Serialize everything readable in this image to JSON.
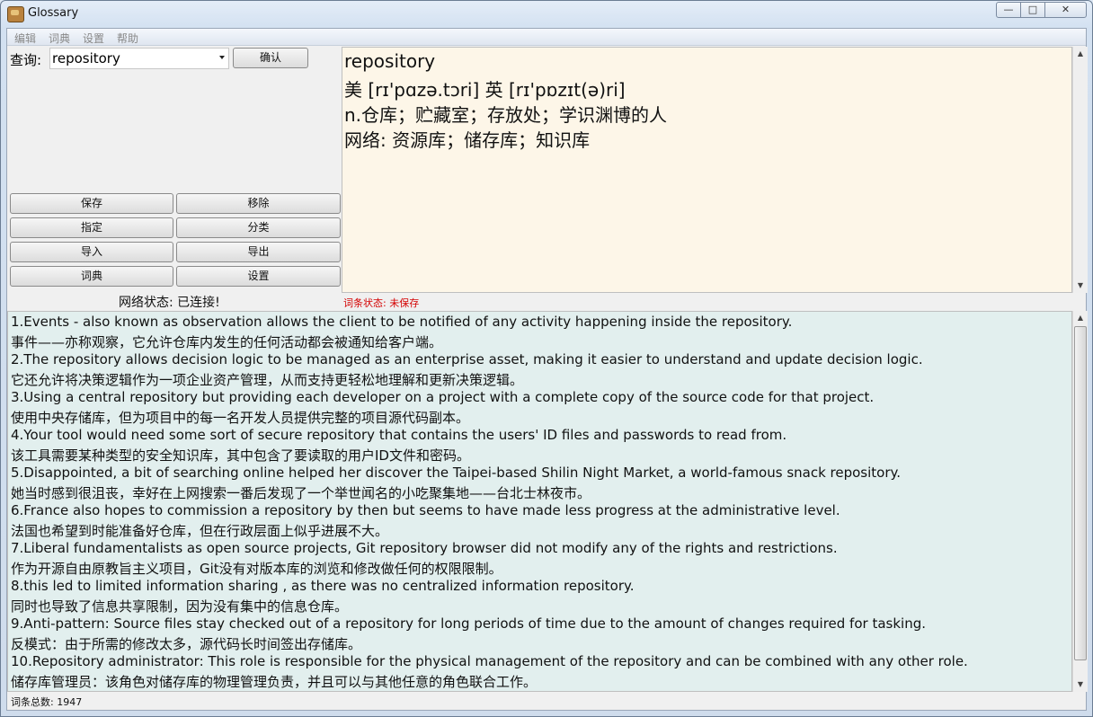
{
  "window": {
    "title": "Glossary",
    "min_symbol": "—",
    "max_symbol": "□",
    "close_symbol": "✕"
  },
  "menu": [
    "编辑",
    "词典",
    "设置",
    "帮助"
  ],
  "query": {
    "label": "查询:",
    "value": "repository",
    "confirm_label": "确认"
  },
  "buttons": [
    "保存",
    "移除",
    "指定",
    "分类",
    "导入",
    "导出",
    "词典",
    "设置"
  ],
  "definition": {
    "word": "repository",
    "phonetic": "美 [rɪ'pɑzə.tɔri] 英 [rɪ'pɒzɪt(ə)ri]",
    "meaning": "n.仓库；贮藏室；存放处；学识渊博的人",
    "web": "网络: 资源库；储存库；知识库"
  },
  "status": {
    "network": "网络状态: 已连接!",
    "entry": "词条状态: 未保存",
    "total": "词条总数: 1947"
  },
  "examples": [
    "1.Events - also known as observation allows the client to be notified of any activity happening inside the repository.",
    "事件——亦称观察，它允许仓库内发生的任何活动都会被通知给客户端。",
    "2.The repository allows decision logic to be managed as an enterprise asset, making it easier to understand and update decision logic.",
    "它还允许将决策逻辑作为一项企业资产管理，从而支持更轻松地理解和更新决策逻辑。",
    "3.Using a central repository but providing each developer on a project with a complete copy of the source code for that project.",
    "使用中央存储库，但为项目中的每一名开发人员提供完整的项目源代码副本。",
    "4.Your tool would need some sort of secure repository that contains the users' ID files and passwords to read from.",
    "该工具需要某种类型的安全知识库，其中包含了要读取的用户ID文件和密码。",
    "5.Disappointed, a bit of searching online helped her discover the Taipei-based Shilin Night Market, a world-famous snack repository.",
    "她当时感到很沮丧，幸好在上网搜索一番后发现了一个举世闻名的小吃聚集地——台北士林夜市。",
    "6.France also hopes to commission a repository by then but seems to have made less progress at the administrative level.",
    "法国也希望到时能准备好仓库，但在行政层面上似乎进展不大。",
    "7.Liberal fundamentalists as open source projects, Git repository browser did not modify any of the rights and restrictions.",
    "作为开源自由原教旨主义项目，Git没有对版本库的浏览和修改做任何的权限限制。",
    "8.this led to limited information sharing , as there was no centralized information repository.",
    "同时也导致了信息共享限制，因为没有集中的信息仓库。",
    "9.Anti-pattern: Source files stay checked out of a repository for long periods of time due to the amount of changes required for tasking.",
    "反模式：由于所需的修改太多，源代码长时间签出存储库。",
    "10.Repository administrator: This role is responsible for the physical management of the repository and can be combined with any other role.",
    "储存库管理员：该角色对储存库的物理管理负责，并且可以与其他任意的角色联合工作。"
  ]
}
